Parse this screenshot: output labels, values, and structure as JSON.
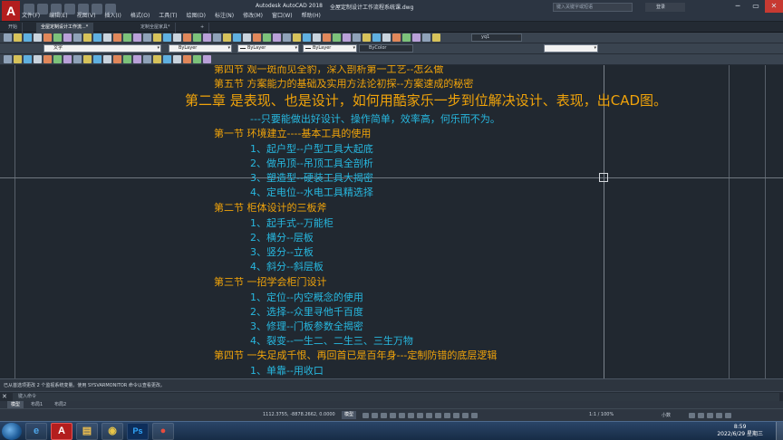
{
  "app": {
    "title": "Autodesk AutoCAD 2018",
    "file_name": "全屋定制设计工作流程系统课.dwg",
    "search_placeholder": "键入关键字或短语",
    "user_label": "登录",
    "menu": [
      "文件(F)",
      "编辑(E)",
      "视图(V)",
      "插入(I)",
      "格式(O)",
      "工具(T)",
      "绘图(D)",
      "标注(N)",
      "修改(M)",
      "窗口(W)",
      "帮助(H)"
    ]
  },
  "tabs": [
    {
      "label": "开始",
      "active": false
    },
    {
      "label": "全屋定制设计工作流...*",
      "active": true
    },
    {
      "label": "定制全屋家具*",
      "active": false
    }
  ],
  "toolbar": {
    "layer_combo": "文字",
    "color_combo": "ByLayer",
    "linetype_combo": "ByLayer",
    "lineweight_combo": "ByLayer",
    "plotstyle_combo": "ByColor",
    "text_style_combo": "yq1",
    "layer_state_combo": ""
  },
  "document": {
    "lines": [
      {
        "text": "第四节  观一斑而见全豹，深入剖析第一工艺--怎么做",
        "color": "orange"
      },
      {
        "text": "第五节  方案能力的基础及实用方法论初探--方案速成的秘密",
        "color": "orange"
      },
      {
        "text": "第二章  是表现、也是设计，如何用酷家乐一步到位解决设计、表现，出CAD图。",
        "color": "orange"
      },
      {
        "text": "---只要能做出好设计、操作简单，效率高，何乐而不为。",
        "color": "blue"
      },
      {
        "text": "第一节  环境建立----基本工具的使用",
        "color": "orange"
      },
      {
        "text": "1、起户型--户型工具大起底",
        "color": "blue"
      },
      {
        "text": "2、做吊顶--吊顶工具全剖析",
        "color": "blue"
      },
      {
        "text": "3、塑造型--硬装工具大揭密",
        "color": "blue"
      },
      {
        "text": "4、定电位--水电工具精选择",
        "color": "blue"
      },
      {
        "text": "第二节  柜体设计的三板斧",
        "color": "orange"
      },
      {
        "text": "1、起手式--万能柜",
        "color": "blue"
      },
      {
        "text": "2、横分--层板",
        "color": "blue"
      },
      {
        "text": "3、竖分--立板",
        "color": "blue"
      },
      {
        "text": "4、斜分--斜层板",
        "color": "blue"
      },
      {
        "text": "第三节  一招学会柜门设计",
        "color": "orange"
      },
      {
        "text": "1、定位--内空概念的使用",
        "color": "blue"
      },
      {
        "text": "2、选择--众里寻他千百度",
        "color": "blue"
      },
      {
        "text": "3、修理--门板参数全揭密",
        "color": "blue"
      },
      {
        "text": "4、裂变--一生二、二生三、三生万物",
        "color": "blue"
      },
      {
        "text": "第四节  一失足成千恨、再回首已是百年身---定制防错的底层逻辑",
        "color": "orange"
      },
      {
        "text": "1、单靠--用收口",
        "color": "blue"
      }
    ]
  },
  "command": {
    "history": "已从首选项更改 2 个监视系统变量。使用 SYSVARMONITOR 命令以查看更改。",
    "prompt_placeholder": "键入命令"
  },
  "layout_tabs": [
    {
      "label": "模型",
      "active": true
    },
    {
      "label": "布局1",
      "active": false
    },
    {
      "label": "布局2",
      "active": false
    }
  ],
  "status": {
    "coordinates": "1112.3755, -8878.2662, 0.0000",
    "model_label": "模型",
    "annotation_scale": "1:1 / 100%",
    "units": "小数"
  },
  "taskbar": {
    "time": "8:59",
    "date": "2022/6/29 星期三"
  },
  "colors": {
    "orange_text": "#f0a30a",
    "blue_text": "#27b8e0",
    "canvas_bg": "#212830"
  },
  "icons": [
    "autocad-logo-icon",
    "start-orb-icon",
    "ie-icon",
    "explorer-icon",
    "chrome-icon",
    "photoshop-icon",
    "recorder-icon"
  ]
}
